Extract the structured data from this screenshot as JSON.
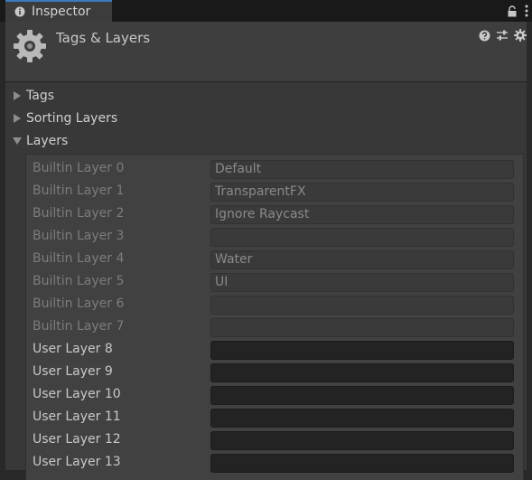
{
  "tab": {
    "label": "Inspector"
  },
  "header": {
    "title": "Tags & Layers"
  },
  "sections": {
    "tags": "Tags",
    "sorting_layers": "Sorting Layers",
    "layers": "Layers"
  },
  "layers": [
    {
      "label": "Builtin Layer 0",
      "value": "Default",
      "builtin": true
    },
    {
      "label": "Builtin Layer 1",
      "value": "TransparentFX",
      "builtin": true
    },
    {
      "label": "Builtin Layer 2",
      "value": "Ignore Raycast",
      "builtin": true
    },
    {
      "label": "Builtin Layer 3",
      "value": "",
      "builtin": true
    },
    {
      "label": "Builtin Layer 4",
      "value": "Water",
      "builtin": true
    },
    {
      "label": "Builtin Layer 5",
      "value": "UI",
      "builtin": true
    },
    {
      "label": "Builtin Layer 6",
      "value": "",
      "builtin": true
    },
    {
      "label": "Builtin Layer 7",
      "value": "",
      "builtin": true
    },
    {
      "label": "User Layer 8",
      "value": "",
      "builtin": false
    },
    {
      "label": "User Layer 9",
      "value": "",
      "builtin": false
    },
    {
      "label": "User Layer 10",
      "value": "",
      "builtin": false
    },
    {
      "label": "User Layer 11",
      "value": "",
      "builtin": false
    },
    {
      "label": "User Layer 12",
      "value": "",
      "builtin": false
    },
    {
      "label": "User Layer 13",
      "value": "",
      "builtin": false
    }
  ],
  "icons": {
    "tab": "info-icon",
    "window": [
      "lock-icon",
      "kebab-menu-icon"
    ],
    "header": [
      "help-icon",
      "preset-icon",
      "gear-icon"
    ],
    "component": "gear-icon"
  }
}
